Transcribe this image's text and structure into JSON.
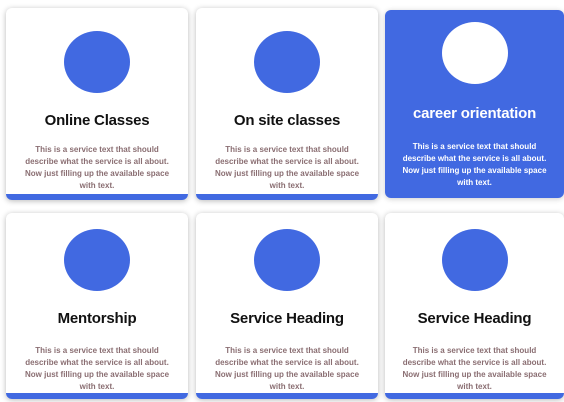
{
  "colors": {
    "accent": "#4169e1",
    "title_text": "#111111",
    "description_text": "#8a6e72",
    "card_background": "#ffffff"
  },
  "cards": [
    {
      "title": "Online Classes",
      "description": "This is a service text that should describe what the service is all about. Now just filling up the available space with text.",
      "icon": "circle-icon",
      "active": false
    },
    {
      "title": "On site classes",
      "description": "This is a service text that should describe what the service is all about. Now just filling up the available space with text.",
      "icon": "circle-icon",
      "active": false
    },
    {
      "title": "career orientation",
      "description": "This is a service text that should describe what the service is all about. Now just filling up the available space with text.",
      "icon": "circle-icon",
      "active": true
    },
    {
      "title": "Mentorship",
      "description": "This is a service text that should describe what the service is all about. Now just filling up the available space with text.",
      "icon": "circle-icon",
      "active": false
    },
    {
      "title": "Service Heading",
      "description": "This is a service text that should describe what the service is all about. Now just filling up the available space with text.",
      "icon": "circle-icon",
      "active": false
    },
    {
      "title": "Service Heading",
      "description": "This is a service text that should describe what the service is all about. Now just filling up the available space with text.",
      "icon": "circle-icon",
      "active": false
    }
  ]
}
